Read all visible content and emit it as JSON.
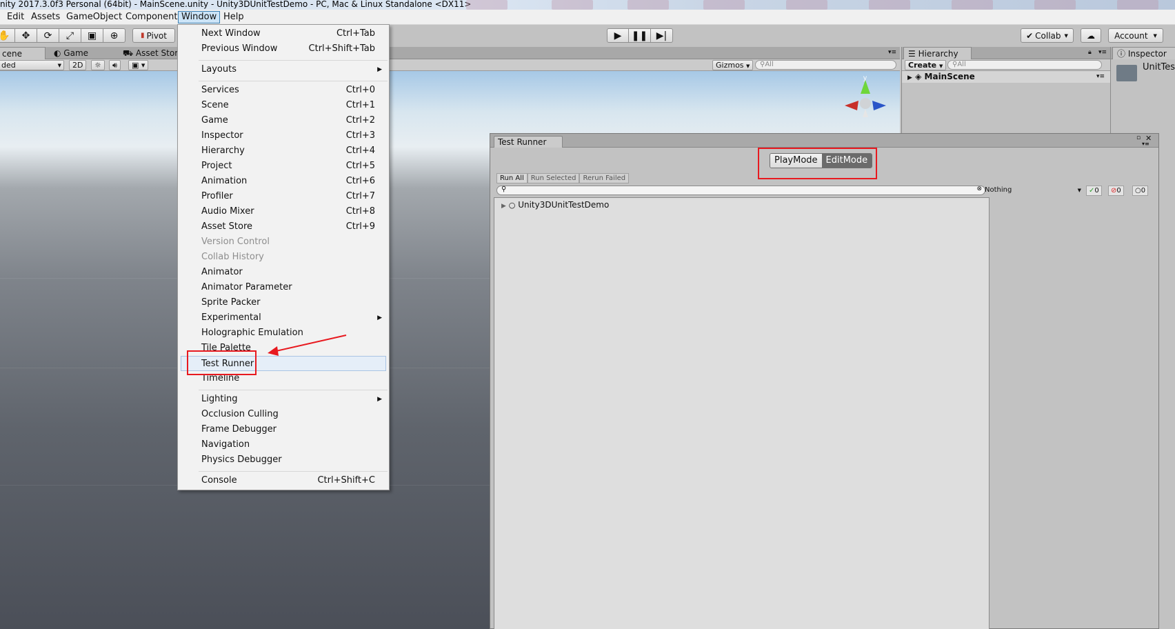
{
  "window": {
    "title": "nity 2017.3.0f3 Personal (64bit) - MainScene.unity - Unity3DUnitTestDemo - PC, Mac & Linux Standalone <DX11>"
  },
  "menubar": {
    "items": [
      "Edit",
      "Assets",
      "GameObject",
      "Component",
      "Window",
      "Help"
    ]
  },
  "toolbar": {
    "pivot": "Pivot",
    "collab": "Collab",
    "account": "Account"
  },
  "scene": {
    "tabs": [
      "cene",
      "Game",
      "Asset Store"
    ],
    "shading": "ded",
    "mode_2d": "2D",
    "gizmos": "Gizmos",
    "search_placeholder": "All",
    "gizmo_axis_y": "y"
  },
  "hierarchy": {
    "tab": "Hierarchy",
    "create": "Create",
    "search_placeholder": "All",
    "scene_name": "MainScene"
  },
  "inspector": {
    "tab": "Inspector",
    "object_name": "UnitTes"
  },
  "window_menu": {
    "items": [
      {
        "label": "Next Window",
        "shortcut": "Ctrl+Tab"
      },
      {
        "label": "Previous Window",
        "shortcut": "Ctrl+Shift+Tab"
      },
      {
        "label": "Layouts",
        "shortcut": ""
      },
      {
        "label": "Services",
        "shortcut": "Ctrl+0"
      },
      {
        "label": "Scene",
        "shortcut": "Ctrl+1"
      },
      {
        "label": "Game",
        "shortcut": "Ctrl+2"
      },
      {
        "label": "Inspector",
        "shortcut": "Ctrl+3"
      },
      {
        "label": "Hierarchy",
        "shortcut": "Ctrl+4"
      },
      {
        "label": "Project",
        "shortcut": "Ctrl+5"
      },
      {
        "label": "Animation",
        "shortcut": "Ctrl+6"
      },
      {
        "label": "Profiler",
        "shortcut": "Ctrl+7"
      },
      {
        "label": "Audio Mixer",
        "shortcut": "Ctrl+8"
      },
      {
        "label": "Asset Store",
        "shortcut": "Ctrl+9"
      },
      {
        "label": "Version Control",
        "shortcut": ""
      },
      {
        "label": "Collab History",
        "shortcut": ""
      },
      {
        "label": "Animator",
        "shortcut": ""
      },
      {
        "label": "Animator Parameter",
        "shortcut": ""
      },
      {
        "label": "Sprite Packer",
        "shortcut": ""
      },
      {
        "label": "Experimental",
        "shortcut": ""
      },
      {
        "label": "Holographic Emulation",
        "shortcut": ""
      },
      {
        "label": "Tile Palette",
        "shortcut": ""
      },
      {
        "label": "Test Runner",
        "shortcut": ""
      },
      {
        "label": "Timeline",
        "shortcut": ""
      },
      {
        "label": "Lighting",
        "shortcut": ""
      },
      {
        "label": "Occlusion Culling",
        "shortcut": ""
      },
      {
        "label": "Frame Debugger",
        "shortcut": ""
      },
      {
        "label": "Navigation",
        "shortcut": ""
      },
      {
        "label": "Physics Debugger",
        "shortcut": ""
      },
      {
        "label": "Console",
        "shortcut": "Ctrl+Shift+C"
      }
    ]
  },
  "test_runner": {
    "tab": "Test Runner",
    "modes": [
      "PlayMode",
      "EditMode"
    ],
    "active_mode": "EditMode",
    "actions": [
      "Run All",
      "Run Selected",
      "Rerun Failed"
    ],
    "filter": "Nothing",
    "counts": {
      "passed": "0",
      "failed": "0",
      "not_run": "0"
    },
    "root": "Unity3DUnitTestDemo"
  }
}
